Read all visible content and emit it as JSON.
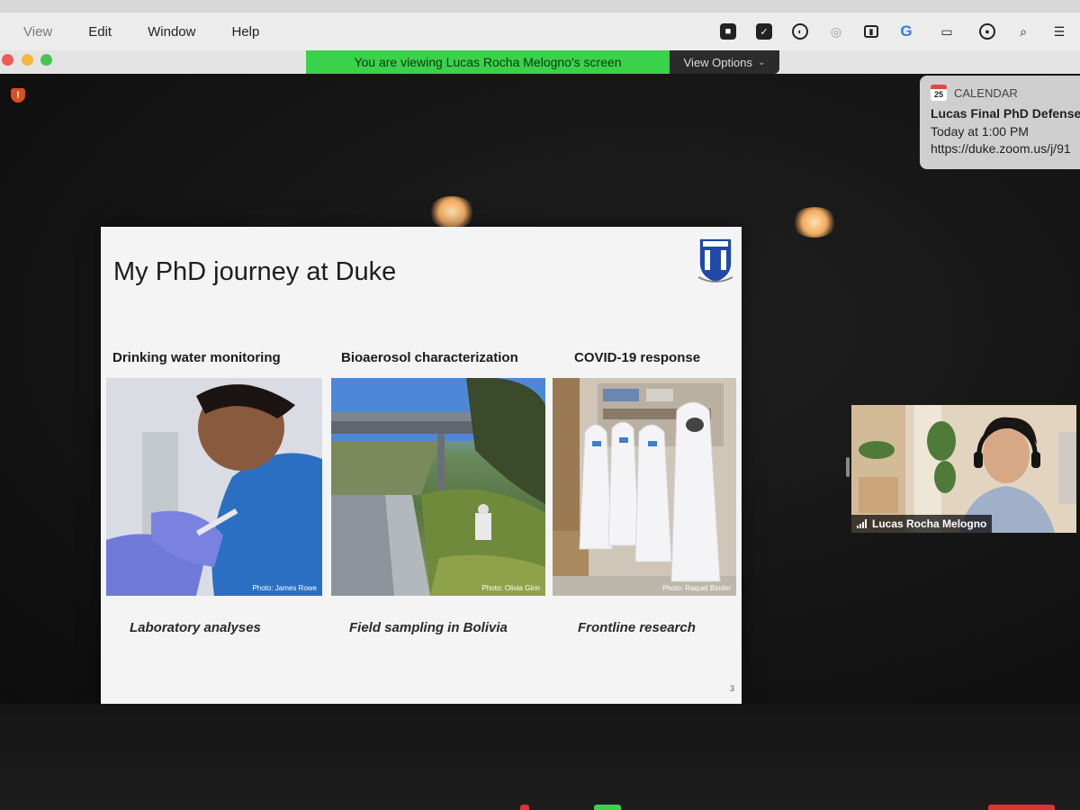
{
  "menubar": {
    "items": [
      "View",
      "Edit",
      "Window",
      "Help"
    ]
  },
  "titlebar": {
    "share_banner": "You are viewing Lucas Rocha Melogno's screen",
    "view_options": "View Options"
  },
  "notification": {
    "app": "CALENDAR",
    "date_badge": "25",
    "title": "Lucas Final PhD Defense",
    "time": "Today at 1:00 PM",
    "link": "https://duke.zoom.us/j/91"
  },
  "slide": {
    "title": "My PhD journey at Duke",
    "page_number": "3",
    "columns": [
      {
        "heading": "Drinking water monitoring",
        "credit": "Photo: James Rowe",
        "caption": "Laboratory analyses"
      },
      {
        "heading": "Bioaerosol characterization",
        "credit": "Photo: Olivia Ginn",
        "caption": "Field sampling in Bolivia"
      },
      {
        "heading": "COVID-19 response",
        "credit": "Photo: Raquel Binder",
        "caption": "Frontline research"
      }
    ]
  },
  "speaker": {
    "name": "Lucas Rocha Melogno"
  },
  "colors": {
    "share_banner_bg": "#3ad14b",
    "notification_bg": "#cfcfcf",
    "slide_bg": "#f4f4f4"
  }
}
